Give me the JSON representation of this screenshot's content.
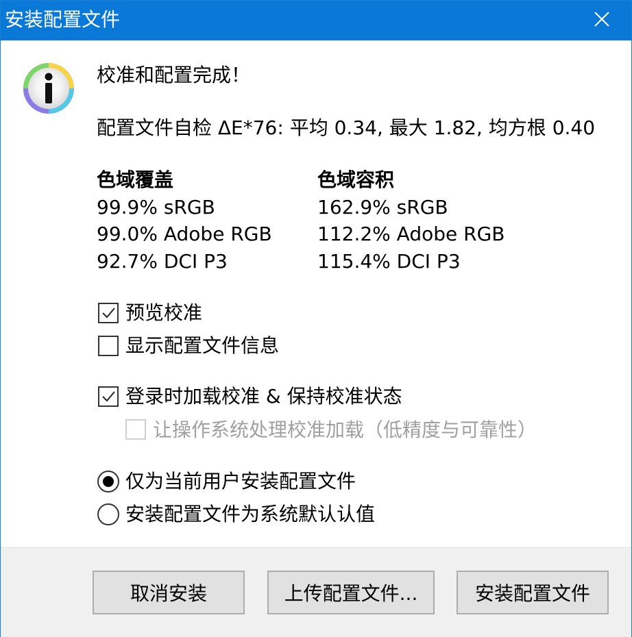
{
  "window": {
    "title": "安装配置文件",
    "title_bar_color": "#0a78d7"
  },
  "icons": {
    "close": "close-icon",
    "info": "info-icon"
  },
  "message": {
    "heading": "校准和配置完成！",
    "selfcheck": "配置文件自检 ΔE*76: 平均 0.34, 最大 1.82, 均方根 0.40"
  },
  "gamut": {
    "coverage_header": "色域覆盖",
    "coverage": [
      "99.9% sRGB",
      "99.0% Adobe RGB",
      "92.7% DCI P3"
    ],
    "volume_header": "色域容积",
    "volume": [
      "162.9% sRGB",
      "112.2% Adobe RGB",
      "115.4% DCI P3"
    ]
  },
  "options": {
    "preview_label": "预览校准",
    "preview_checked": true,
    "show_info_label": "显示配置文件信息",
    "show_info_checked": false,
    "load_on_login_label": "登录时加载校准 & 保持校准状态",
    "load_on_login_checked": true,
    "os_handle_label": "让操作系统处理校准加载（低精度与可靠性）",
    "os_handle_checked": false,
    "os_handle_enabled": false
  },
  "install_scope": {
    "current_user_label": "仅为当前用户安装配置文件",
    "system_default_label": "安装配置文件为系统默认认值",
    "selected": "current_user"
  },
  "buttons": {
    "cancel": "取消安装",
    "upload": "上传配置文件...",
    "install": "安装配置文件"
  }
}
